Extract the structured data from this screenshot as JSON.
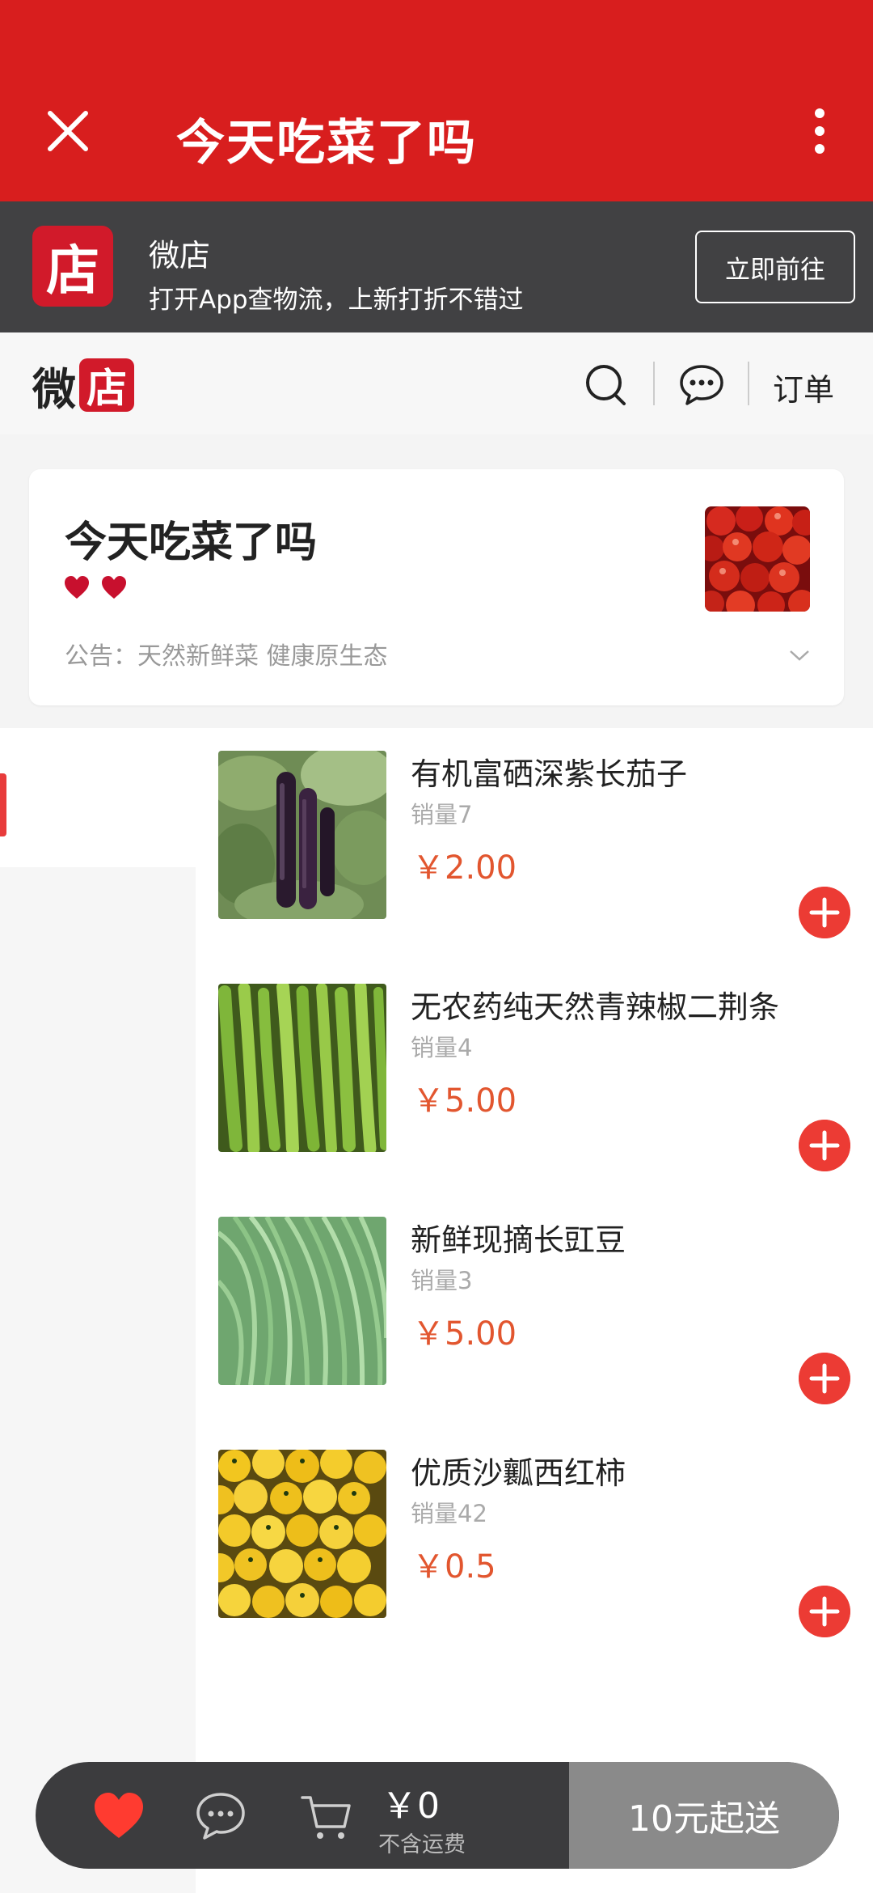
{
  "header": {
    "title": "今天吃菜了吗",
    "accent": "#d81e1e"
  },
  "banner": {
    "logo_char": "店",
    "app_name": "微店",
    "tagline": "打开App查物流，上新打折不错过",
    "cta": "立即前往"
  },
  "nav": {
    "brand_a": "微",
    "brand_b": "店",
    "orders_label": "订单"
  },
  "shop": {
    "name": "今天吃菜了吗",
    "notice": "公告：天然新鲜菜 健康原生态"
  },
  "products": [
    {
      "title": "有机富硒深紫长茄子",
      "sales": "销量7",
      "price": "￥2.00",
      "image": "eggplant"
    },
    {
      "title": "无农药纯天然青辣椒二荆条",
      "sales": "销量4",
      "price": "￥5.00",
      "image": "green-pepper"
    },
    {
      "title": "新鲜现摘长豇豆",
      "sales": "销量3",
      "price": "￥5.00",
      "image": "long-beans"
    },
    {
      "title": "优质沙瓤西红柿",
      "sales": "销量42",
      "price": "￥0.5",
      "image": "yellow-tomatoes"
    }
  ],
  "cart": {
    "total": "￥0",
    "fee_note": "不含运费",
    "min_order": "10元起送"
  },
  "colors": {
    "price": "#e2562f",
    "add_button": "#ec3b34",
    "banner_bg": "#414143"
  }
}
